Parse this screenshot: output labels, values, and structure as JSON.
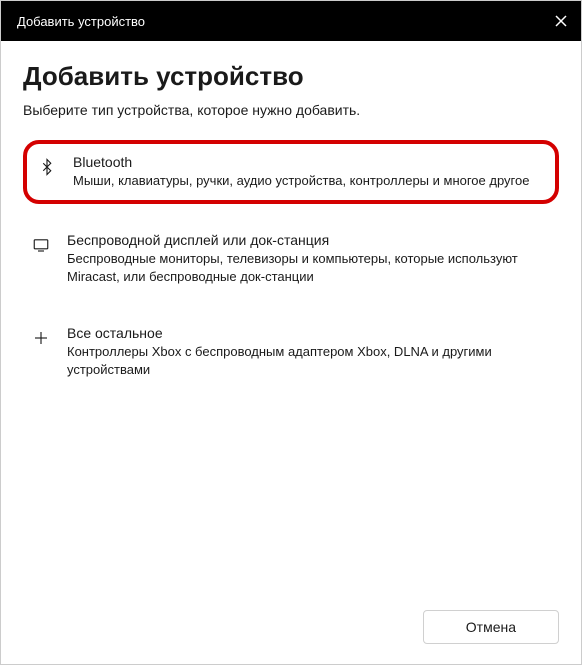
{
  "titlebar": {
    "title": "Добавить устройство"
  },
  "heading": "Добавить устройство",
  "subheading": "Выберите тип устройства, которое нужно добавить.",
  "options": [
    {
      "title": "Bluetooth",
      "desc": "Мыши, клавиатуры, ручки, аудио устройства, контроллеры и многое другое"
    },
    {
      "title": "Беспроводной дисплей или док-станция",
      "desc": "Беспроводные мониторы, телевизоры и компьютеры, которые используют Miracast, или беспроводные док-станции"
    },
    {
      "title": "Все остальное",
      "desc": "Контроллеры Xbox с беспроводным адаптером Xbox, DLNA и другими устройствами"
    }
  ],
  "footer": {
    "cancel_label": "Отмена"
  }
}
